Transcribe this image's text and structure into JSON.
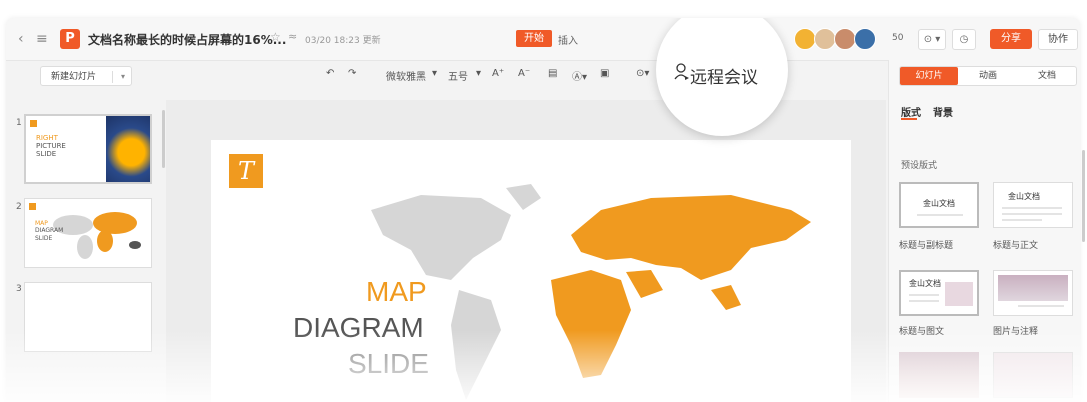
{
  "titlebar": {
    "back_icon": "chevron-left-icon",
    "menu_icon": "hamburger-icon",
    "logo_letter": "P",
    "doc_title": "文档名称最长的时候占屏幕的16%...",
    "star_icon": "star-icon",
    "cloud_icon": "wifi-cloud-icon",
    "updated": "03/20 18:23 更新",
    "tab_start": "开始",
    "tab_insert": "插入",
    "collaborator_count": "50",
    "share": "分享",
    "collab": "协作"
  },
  "toolbar": {
    "new_slide": "新建幻灯片",
    "font_name": "微软雅黑",
    "font_size": "五号",
    "grow": "A⁺",
    "shrink": "A⁻"
  },
  "magnifier": {
    "label": "远程会议"
  },
  "slides": [
    {
      "num": "1",
      "line1": "RIGHT",
      "line2": "PICTURE",
      "line3": "SLIDE"
    },
    {
      "num": "2",
      "line1": "MAP",
      "line2": "DIAGRAM",
      "line3": "SLIDE"
    },
    {
      "num": "3"
    }
  ],
  "slide_main": {
    "logo_letter": "T",
    "title1": "MAP",
    "title2": "DIAGRAM",
    "title3": "SLIDE"
  },
  "right_panel": {
    "tabs": [
      "幻灯片",
      "动画",
      "文档"
    ],
    "sub_tabs": [
      "版式",
      "背景"
    ],
    "preset_title": "预设版式",
    "layouts": [
      {
        "label": "标题与副标题",
        "card_title": "金山文档"
      },
      {
        "label": "标题与正文",
        "card_title": "金山文档"
      },
      {
        "label": "标题与图文",
        "card_title": "金山文档"
      },
      {
        "label": "图片与注释",
        "card_title": ""
      }
    ]
  },
  "colors": {
    "accent": "#f05a28",
    "map_orange": "#f09a1f",
    "map_gray": "#d6d6d6"
  }
}
